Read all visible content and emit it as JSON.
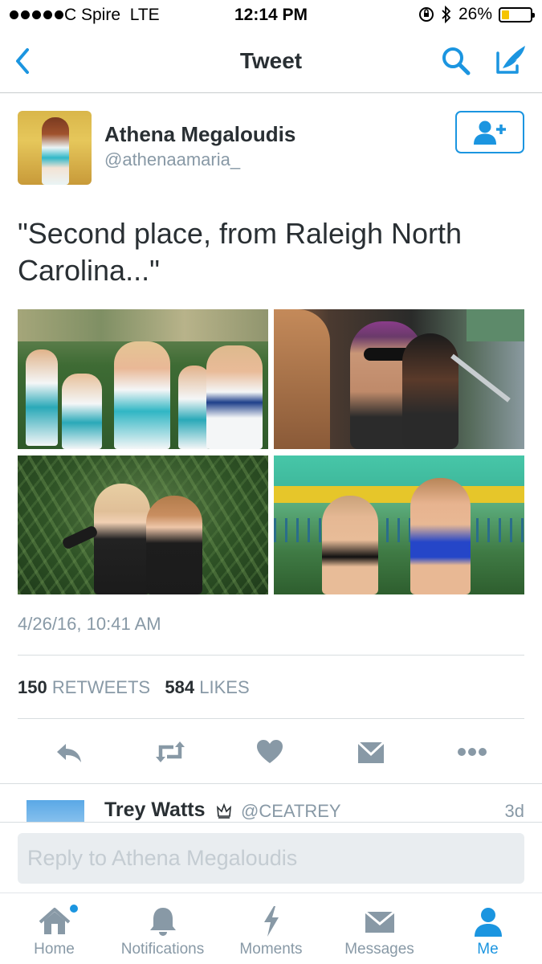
{
  "status_bar": {
    "carrier": "C Spire",
    "network": "LTE",
    "time": "12:14 PM",
    "battery_percent": "26%",
    "battery_level": 0.26,
    "battery_color": "#f5c400"
  },
  "nav": {
    "title": "Tweet",
    "back_icon": "chevron-left-icon",
    "search_icon": "search-icon",
    "compose_icon": "compose-icon"
  },
  "tweet": {
    "user_name": "Athena Megaloudis",
    "user_handle": "@athenaamaria_",
    "text": "\"Second place, from Raleigh North Carolina...\"",
    "timestamp": "4/26/16, 10:41 AM",
    "retweets_count": "150",
    "retweets_label": "RETWEETS",
    "likes_count": "584",
    "likes_label": "LIKES"
  },
  "actions": [
    "reply-icon",
    "retweet-icon",
    "like-icon",
    "direct-message-icon",
    "more-icon"
  ],
  "reply_preview": {
    "name": "Trey Watts",
    "handle": "@CEATREY",
    "time": "3d"
  },
  "composer": {
    "placeholder": "Reply to Athena Megaloudis"
  },
  "tabs": [
    {
      "label": "Home",
      "icon": "home-icon"
    },
    {
      "label": "Notifications",
      "icon": "bell-icon"
    },
    {
      "label": "Moments",
      "icon": "lightning-icon"
    },
    {
      "label": "Messages",
      "icon": "envelope-icon"
    },
    {
      "label": "Me",
      "icon": "person-icon"
    }
  ],
  "colors": {
    "accent": "#1b95e0",
    "text": "#292f33",
    "secondary_text": "#8899a6"
  }
}
